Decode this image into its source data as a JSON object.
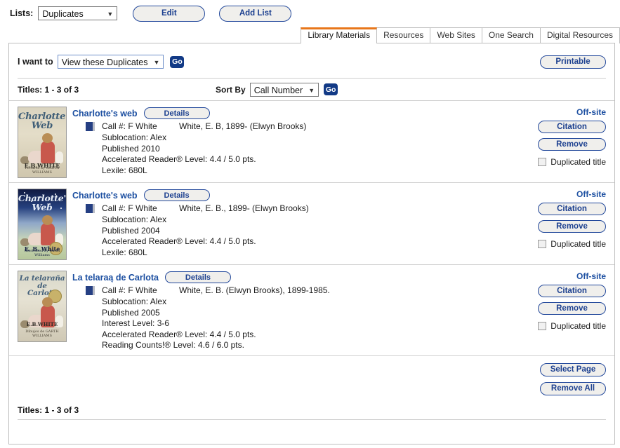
{
  "lists_bar": {
    "label": "Lists:",
    "selected_list": "Duplicates",
    "edit_label": "Edit",
    "add_list_label": "Add List"
  },
  "tabs": [
    {
      "label": "Library Materials",
      "active": true
    },
    {
      "label": "Resources",
      "active": false
    },
    {
      "label": "Web Sites",
      "active": false
    },
    {
      "label": "One Search",
      "active": false
    },
    {
      "label": "Digital Resources",
      "active": false
    }
  ],
  "toolbar": {
    "i_want_to_label": "I want to",
    "action_selected": "View these Duplicates",
    "go_label": "Go",
    "printable_label": "Printable"
  },
  "results_header": {
    "titles_count": "Titles: 1 - 3 of 3",
    "sort_by_label": "Sort By",
    "sort_selected": "Call Number",
    "go_label": "Go"
  },
  "records": [
    {
      "title": "Charlotte's web",
      "details_label": "Details",
      "call_number": "Call #: F White",
      "author": "White, E. B, 1899- (Elwyn Brooks)",
      "meta": [
        "Sublocation: Alex",
        "Published 2010",
        "Accelerated Reader® Level: 4.4 / 5.0 pts.",
        "Lexile: 680L"
      ],
      "location_status": "Off-site",
      "citation_label": "Citation",
      "remove_label": "Remove",
      "duplicate_label": "Duplicated title",
      "duplicate_checked": false,
      "cover": {
        "title_line1": "Charlotte's",
        "title_line2": "Web",
        "author": "E.B.WHITE",
        "subtext": "Pictures by GARTH WILLIAMS"
      }
    },
    {
      "title": "Charlotte's web",
      "details_label": "Details",
      "call_number": "Call #: F White",
      "author": "White, E. B., 1899- (Elwyn Brooks)",
      "meta": [
        "Sublocation: Alex",
        "Published 2004",
        "Accelerated Reader® Level: 4.4 / 5.0 pts.",
        "Lexile: 680L"
      ],
      "location_status": "Off-site",
      "citation_label": "Citation",
      "remove_label": "Remove",
      "duplicate_label": "Duplicated title",
      "duplicate_checked": false,
      "cover": {
        "title_line1": "Charlotte's",
        "title_line2": "Web",
        "author": "E. B. White",
        "subtext": "Illustrated by Garth Williams"
      }
    },
    {
      "title": "La telaraą de Carlota",
      "details_label": "Details",
      "call_number": "Call #: F White",
      "author": "White, E. B. (Elwyn Brooks), 1899-1985.",
      "meta": [
        "Sublocation: Alex",
        "Published 2005",
        "Interest Level: 3-6",
        "Accelerated Reader® Level: 4.4 / 5.0 pts.",
        "Reading Counts!® Level: 4.6 / 6.0 pts."
      ],
      "location_status": "Off-site",
      "citation_label": "Citation",
      "remove_label": "Remove",
      "duplicate_label": "Duplicated title",
      "duplicate_checked": false,
      "cover": {
        "title_line1": "La telaraña de",
        "title_line2": "Carlota",
        "author": "E.B.WHITE",
        "subtext": "Dibujos de GARTH WILLIAMS"
      }
    }
  ],
  "bottom_actions": {
    "select_page_label": "Select Page",
    "remove_all_label": "Remove All"
  },
  "footer": {
    "titles_count": "Titles: 1 - 3 of 3"
  },
  "colors": {
    "accent_orange": "#e8761a",
    "link_blue": "#1c4fa1",
    "button_blue": "#22489b",
    "go_blue": "#123a86"
  }
}
